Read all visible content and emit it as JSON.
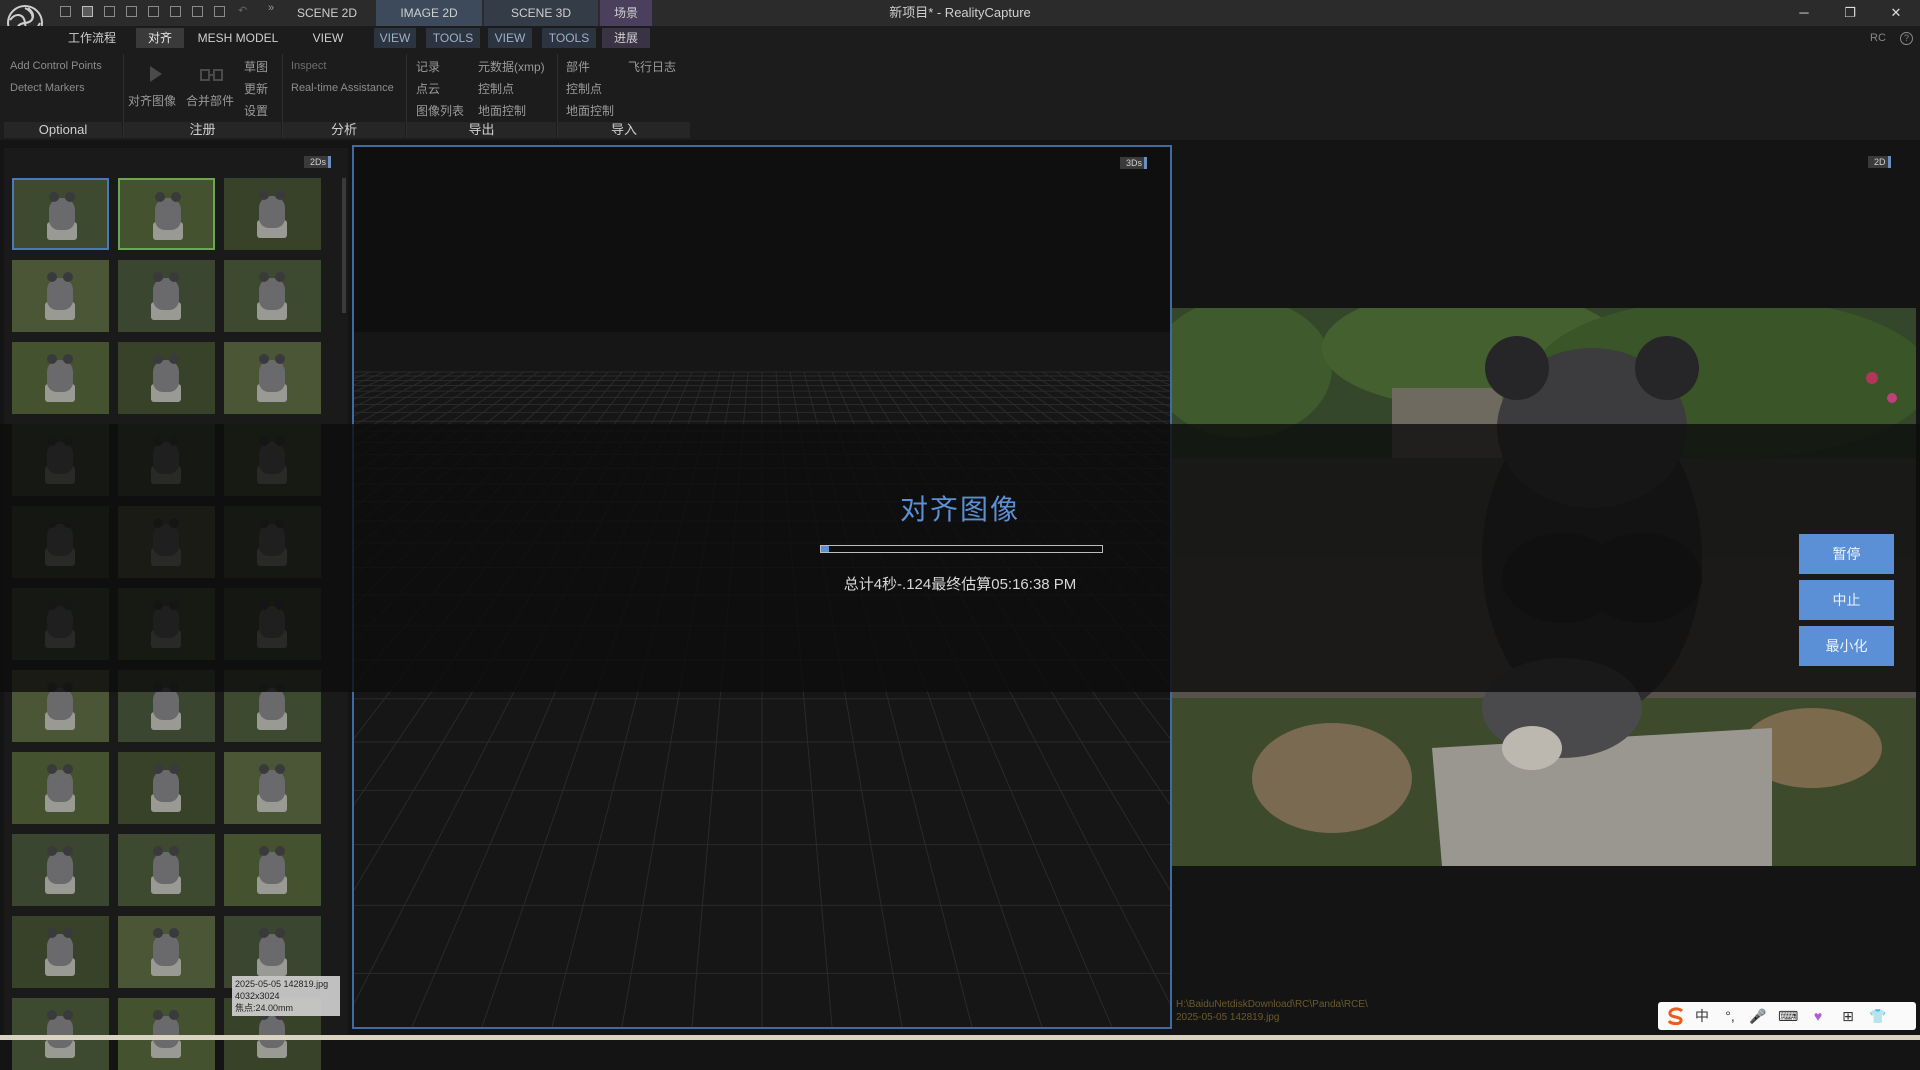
{
  "window": {
    "title": "新项目* - RealityCapture",
    "controls": {
      "minimize": "─",
      "restore": "❐",
      "close": "✕"
    }
  },
  "quick_access": {
    "undo": "↶",
    "more": "»"
  },
  "top_tabs": [
    "SCENE 2D",
    "IMAGE 2D",
    "SCENE 3D",
    "场景"
  ],
  "menu": {
    "tabs": [
      "工作流程",
      "对齐",
      "MESH MODEL",
      "VIEW"
    ],
    "sub_tabs_1": [
      "VIEW",
      "TOOLS"
    ],
    "sub_tabs_2": [
      "VIEW",
      "TOOLS",
      "进展"
    ],
    "rc": "RC",
    "help": "?"
  },
  "ribbon": {
    "optional": {
      "items": [
        "Add Control Points",
        "Detect Markers"
      ],
      "label": "Optional"
    },
    "registration": {
      "align_button": "对齐图像",
      "merge_button": "合并部件",
      "items": [
        "草图",
        "更新",
        "设置"
      ],
      "label": "注册"
    },
    "analysis": {
      "items": [
        "Inspect",
        "Real-time Assistance"
      ],
      "label": "分析"
    },
    "export": {
      "items": [
        "记录",
        "点云",
        "图像列表"
      ],
      "items2": [
        "元数据(xmp)",
        "控制点",
        "地面控制"
      ],
      "label": "导出"
    },
    "import": {
      "items": [
        "部件",
        "控制点",
        "地面控制"
      ],
      "flight_log": "飞行日志",
      "label": "导入"
    }
  },
  "left_panel": {
    "badge": "2Ds",
    "tooltip": {
      "file": "2025-05-05 142819.jpg",
      "resolution": "4032x3024",
      "focal": "焦点:24.00mm"
    }
  },
  "center_panel": {
    "badge": "3Ds"
  },
  "right_panel": {
    "badge": "2D",
    "path_line1": "H:\\BaiduNetdiskDownload\\RC\\Panda\\RCE\\",
    "path_line2": "2025-05-05 142819.jpg"
  },
  "progress": {
    "title": "对齐图像",
    "status": "总计4秒-.124最终估算05:16:38 PM",
    "fraction": 0.03,
    "buttons": {
      "pause": "暂停",
      "abort": "中止",
      "minimize": "最小化"
    }
  },
  "ime": {
    "lang": "中",
    "items": [
      "°,",
      "🎤",
      "⌨",
      "♥",
      "⊞",
      "👕"
    ]
  },
  "colors": {
    "accent": "#5b8fd6",
    "selection_border": "#3f6aa3",
    "thumb_green": "#6aa84f"
  }
}
